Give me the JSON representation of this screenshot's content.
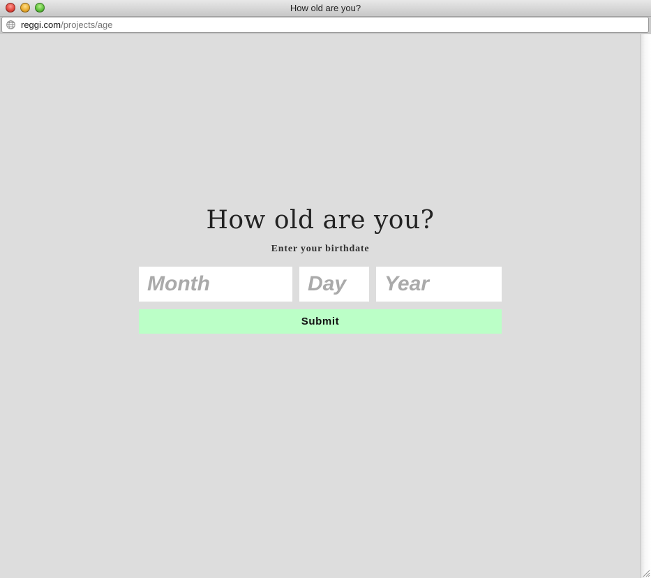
{
  "window": {
    "title": "How old are you?"
  },
  "address_bar": {
    "host": "reggi.com",
    "path": "/projects/age"
  },
  "main": {
    "heading": "How old are you?",
    "subheading": "Enter your birthdate",
    "fields": {
      "month": {
        "placeholder": "Month",
        "value": ""
      },
      "day": {
        "placeholder": "Day",
        "value": ""
      },
      "year": {
        "placeholder": "Year",
        "value": ""
      }
    },
    "submit_label": "Submit"
  },
  "colors": {
    "page_background": "#dddddd",
    "submit_background": "#bbffc7",
    "input_background": "#ffffff",
    "placeholder_text": "#aaaaaa"
  },
  "icons": {
    "address_icon": "globe-icon",
    "window_controls": [
      "close-icon",
      "minimize-icon",
      "maximize-icon"
    ]
  }
}
